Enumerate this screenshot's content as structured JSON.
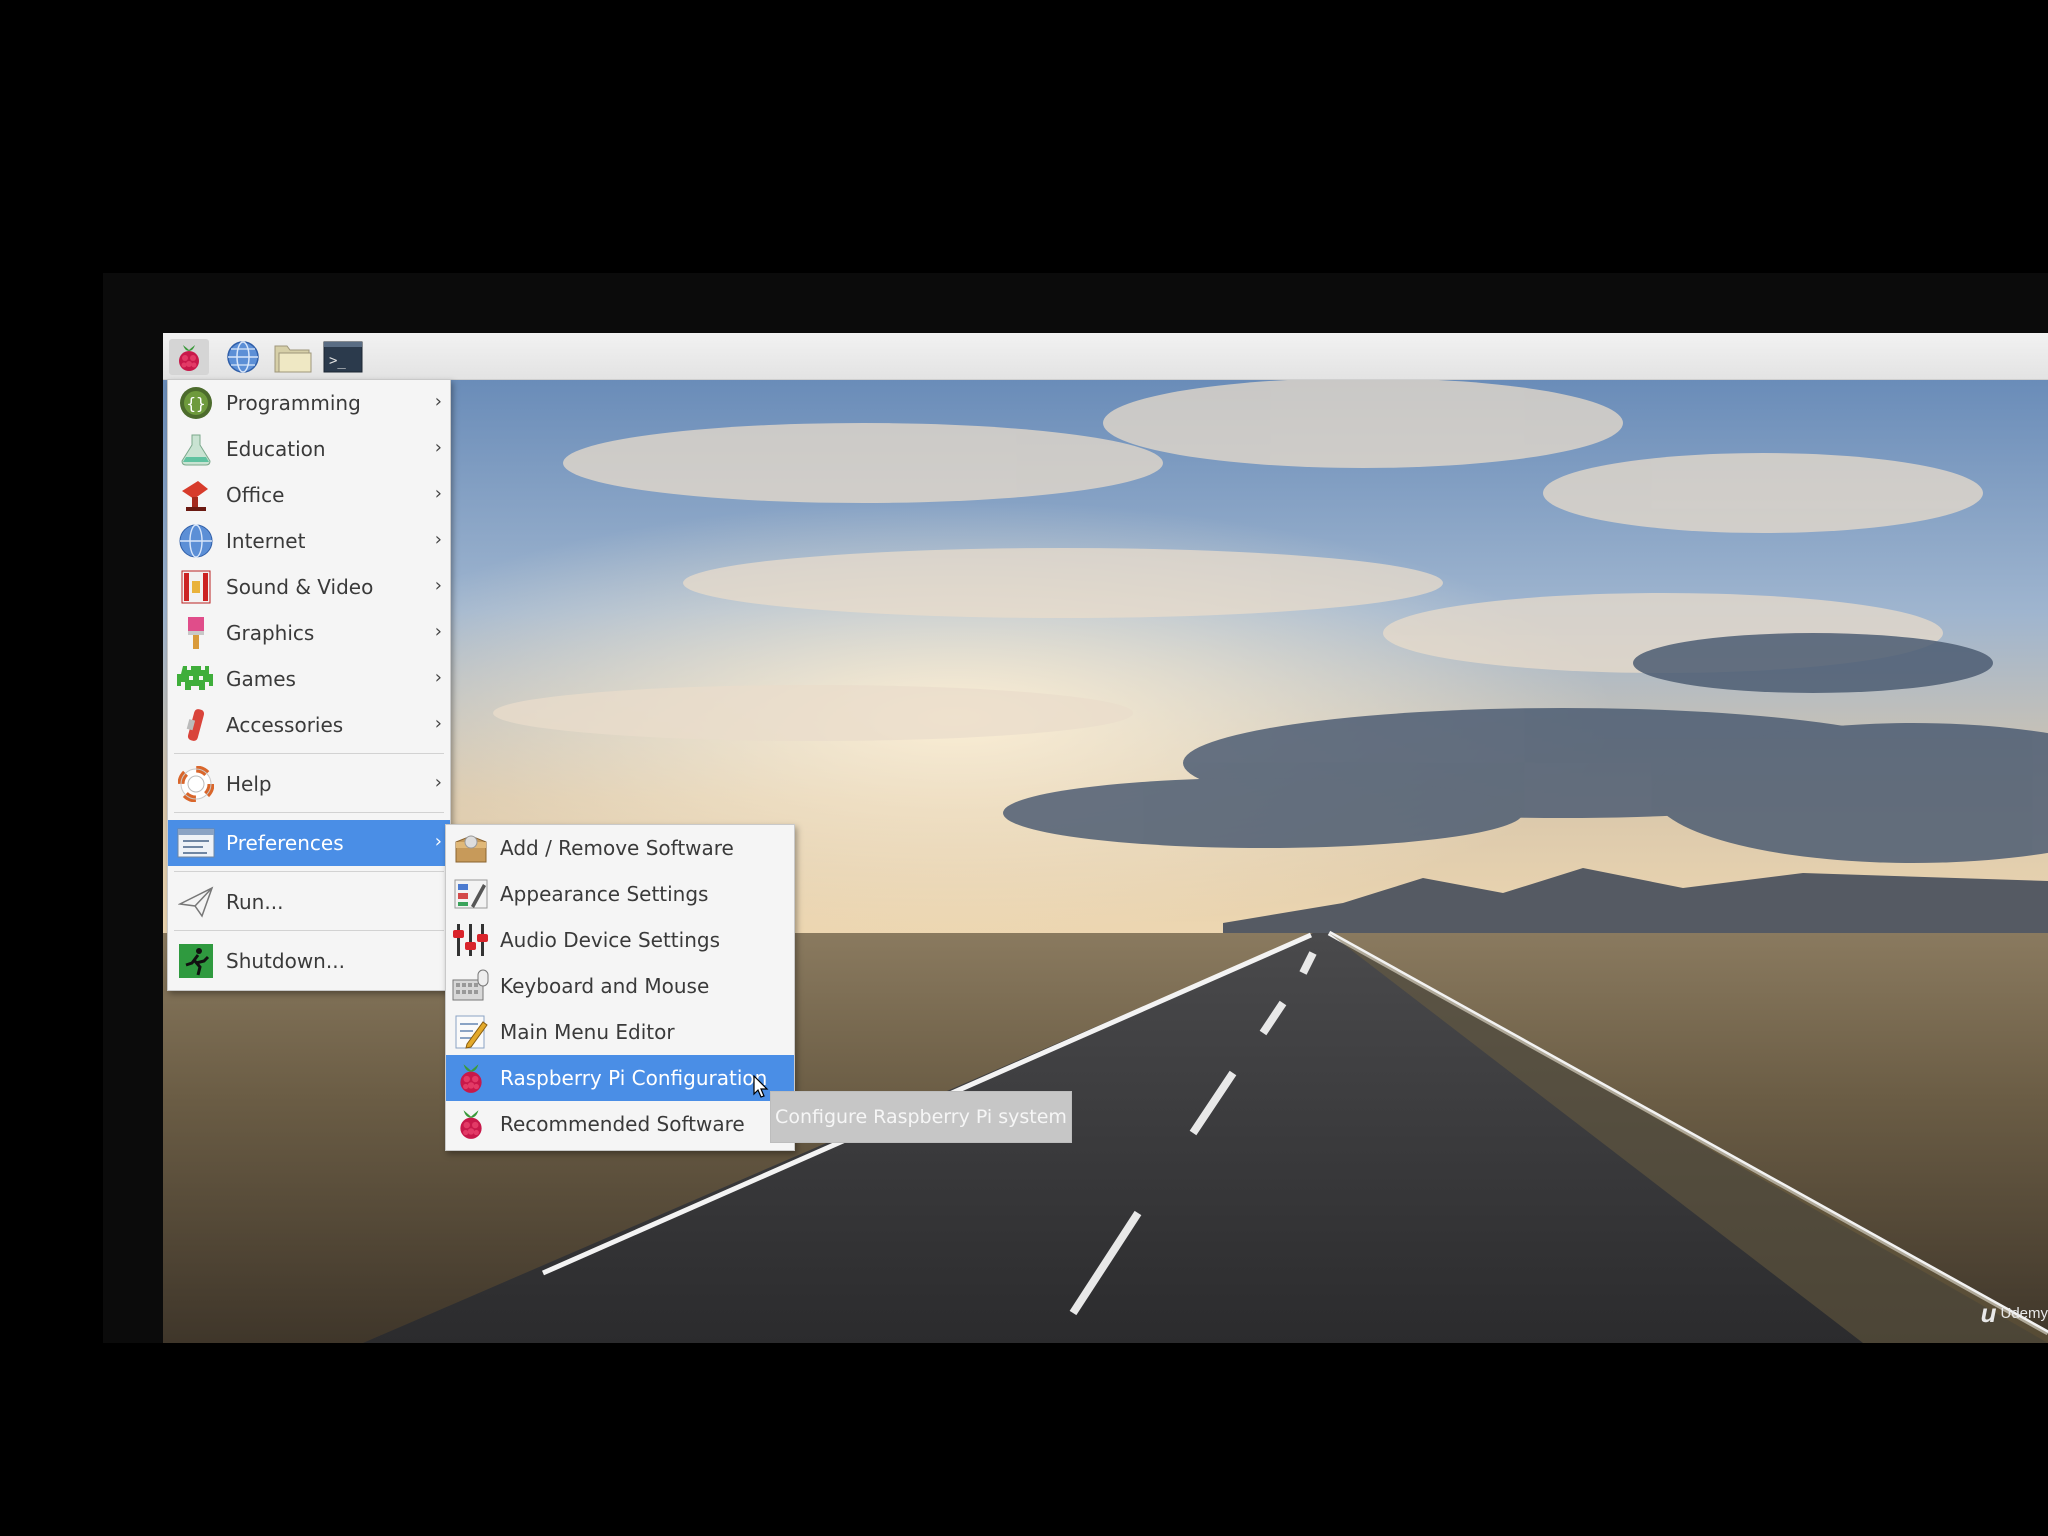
{
  "taskbar": {
    "buttons": [
      {
        "name": "raspberry-menu-icon"
      },
      {
        "name": "web-browser-icon"
      },
      {
        "name": "file-manager-icon"
      },
      {
        "name": "terminal-icon"
      }
    ]
  },
  "main_menu": {
    "items": [
      {
        "label": "Programming",
        "icon": "programming-icon",
        "submenu": true
      },
      {
        "label": "Education",
        "icon": "education-icon",
        "submenu": true
      },
      {
        "label": "Office",
        "icon": "office-icon",
        "submenu": true
      },
      {
        "label": "Internet",
        "icon": "internet-icon",
        "submenu": true
      },
      {
        "label": "Sound & Video",
        "icon": "sound-video-icon",
        "submenu": true
      },
      {
        "label": "Graphics",
        "icon": "graphics-icon",
        "submenu": true
      },
      {
        "label": "Games",
        "icon": "games-icon",
        "submenu": true
      },
      {
        "label": "Accessories",
        "icon": "accessories-icon",
        "submenu": true
      },
      {
        "label": "Help",
        "icon": "help-icon",
        "submenu": true
      },
      {
        "label": "Preferences",
        "icon": "preferences-icon",
        "submenu": true,
        "active": true
      },
      {
        "label": "Run...",
        "icon": "run-icon",
        "submenu": false
      },
      {
        "label": "Shutdown...",
        "icon": "shutdown-icon",
        "submenu": false
      }
    ],
    "arrow": "›"
  },
  "preferences_menu": {
    "items": [
      {
        "label": "Add / Remove Software",
        "icon": "package-icon"
      },
      {
        "label": "Appearance Settings",
        "icon": "appearance-icon"
      },
      {
        "label": "Audio Device Settings",
        "icon": "audio-mixer-icon"
      },
      {
        "label": "Keyboard and Mouse",
        "icon": "keyboard-icon"
      },
      {
        "label": "Main Menu Editor",
        "icon": "menu-editor-icon"
      },
      {
        "label": "Raspberry Pi Configuration",
        "icon": "raspberry-icon",
        "active": true
      },
      {
        "label": "Recommended Software",
        "icon": "raspberry-icon"
      }
    ]
  },
  "tooltip": {
    "text": "Configure Raspberry Pi system"
  },
  "watermark": {
    "logo": "u",
    "text": "Udemy"
  },
  "colors": {
    "highlight": "#4a8ee6",
    "menu_bg": "#f5f5f5",
    "taskbar": "#eaeaea"
  }
}
